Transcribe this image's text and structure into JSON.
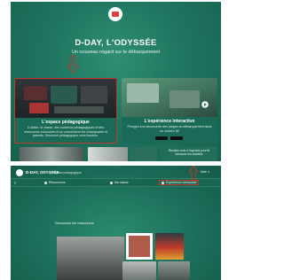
{
  "top": {
    "title": "D-DAY, L'ODYSSÉE",
    "subtitle": "Un nouveau regard sur le débarquement",
    "card_left": {
      "title": "L'espace pédagogique",
      "desc": "Il atelier, le classe, des contenus pédagogiques et des ressources exclusives et se concentrent les enseignants et parents. Découvrir pédagogique vous fonction."
    },
    "card_right": {
      "title": "L'expérience interactive",
      "desc": "Plongez à la découverte des plages du débarquement dans un univers 3D"
    },
    "cta": {
      "text": "Rendez-vous à l'agenda pour le retrouver les activités"
    }
  },
  "bottom": {
    "brand": "D-DAY, ODYSSÉE",
    "brand_sub": "| Espace pédagogique",
    "topbar_right": "Aide ∨",
    "nav": {
      "menu_icon": "≡",
      "item1": "Ressources",
      "item2": "Ma classe",
      "item3": "Expérience interactive"
    },
    "section_title": "Découvrez les ressources"
  },
  "colors": {
    "accent_green": "#1f7560",
    "highlight_red": "#c0392b"
  },
  "icons": [
    "logo-icon",
    "down-arrow-icon",
    "up-arrow-icon",
    "play-icon",
    "menu-icon"
  ]
}
